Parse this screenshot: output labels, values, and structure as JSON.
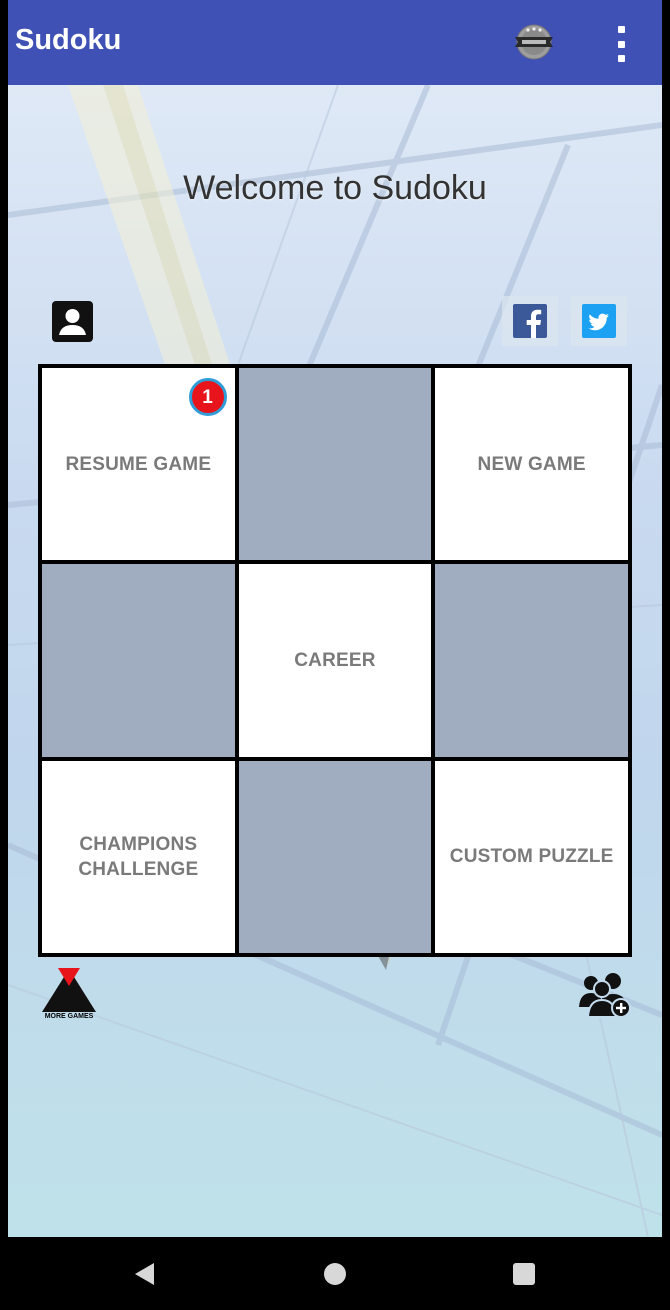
{
  "app_bar": {
    "title": "Sudoku",
    "leaderboard_icon": "leaderboard-badge-icon",
    "overflow_icon": "more-vert-icon",
    "color": "#3f51b5"
  },
  "main": {
    "welcome_text": "Welcome to Sudoku",
    "profile_icon": "account-box-icon",
    "facebook_icon": "facebook-icon",
    "twitter_icon": "twitter-icon"
  },
  "menu": {
    "resume_game": "RESUME GAME",
    "resume_badge_count": "1",
    "new_game": "NEW GAME",
    "career": "CAREER",
    "champions_challenge": "CHAMPIONS CHALLENGE",
    "custom_puzzle": "CUSTOM PUZZLE"
  },
  "footer": {
    "more_games_label": "MORE GAMES",
    "add_friends_icon": "add-friends-icon"
  },
  "system_nav": {
    "back_icon": "back-triangle-icon",
    "home_icon": "home-circle-icon",
    "recents_icon": "recents-square-icon"
  },
  "colors": {
    "badge_red": "#e8141b",
    "badge_ring": "#2f9ed8",
    "menu_text": "#7a7a7a",
    "facebook": "#3b5998",
    "twitter": "#1da1f2"
  }
}
